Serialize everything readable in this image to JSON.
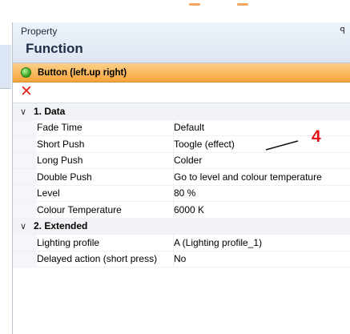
{
  "panel": {
    "title": "Property",
    "function_title": "Function"
  },
  "item": {
    "label": "Button (left.up right)"
  },
  "categories": [
    {
      "label": "1. Data",
      "rows": [
        {
          "name": "Fade Time",
          "value": "Default"
        },
        {
          "name": "Short Push",
          "value": "Toogle (effect)"
        },
        {
          "name": "Long Push",
          "value": "Colder"
        },
        {
          "name": "Double Push",
          "value": "Go to level and colour temperature"
        },
        {
          "name": "Level",
          "value": "80 %"
        },
        {
          "name": "Colour Temperature",
          "value": "6000 K"
        }
      ]
    },
    {
      "label": "2. Extended",
      "rows": [
        {
          "name": "Lighting profile",
          "value": "A (Lighting profile_1)"
        },
        {
          "name": "Delayed action (short press)",
          "value": "No"
        }
      ]
    }
  ],
  "annotation": {
    "number": "4"
  },
  "icons": {
    "pin": "pin-icon",
    "status": "green-circle-icon",
    "delete": "red-x-icon",
    "expand": "chevron-down-icon"
  },
  "colors": {
    "item_bar": "#f4a43a",
    "status_green": "#2f9c1c",
    "delete_red": "#e0291c",
    "annotation_red": "#e01414"
  }
}
